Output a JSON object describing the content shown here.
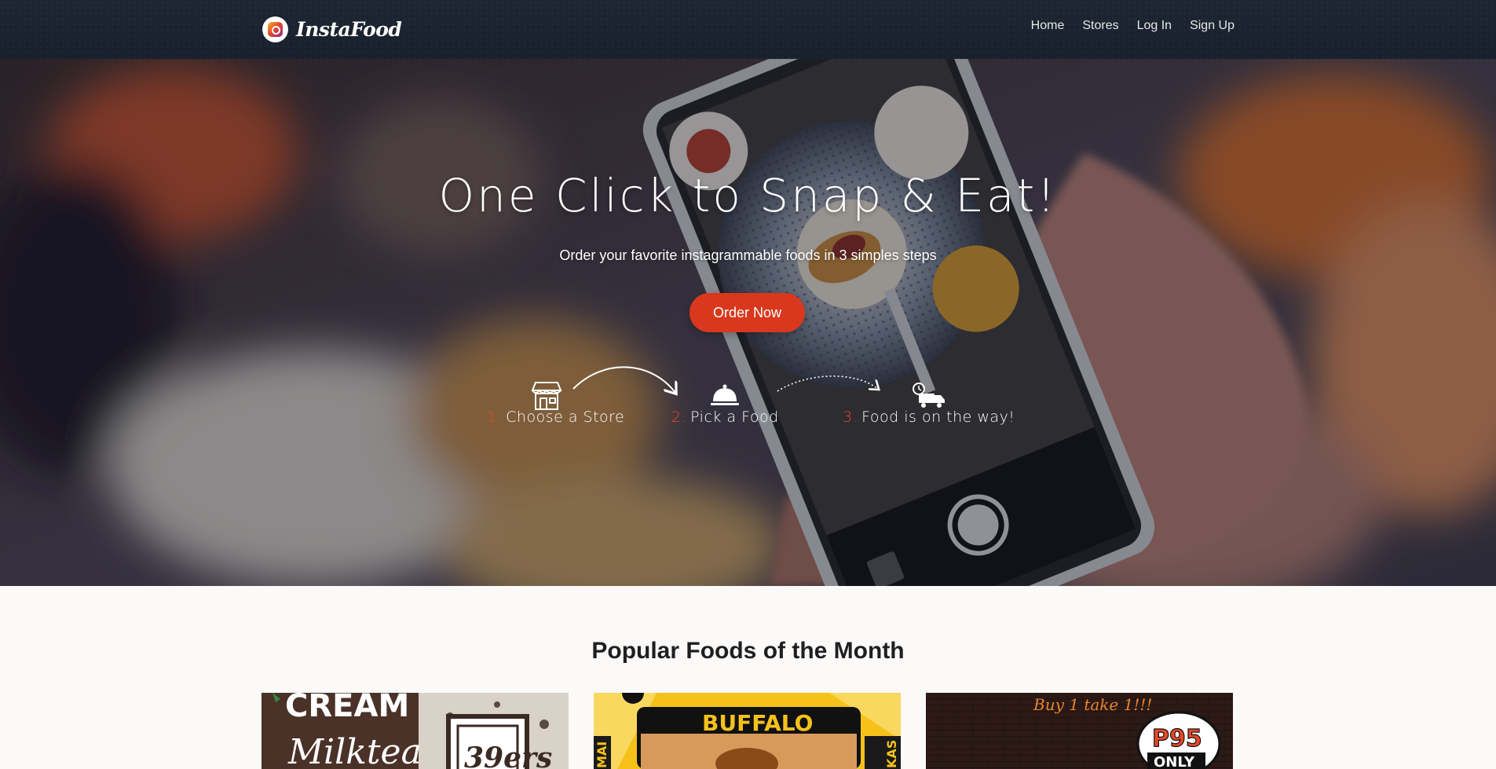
{
  "nav": {
    "brand": "InstaFood",
    "links": [
      "Home",
      "Stores",
      "Log In",
      "Sign Up"
    ]
  },
  "hero": {
    "title": "One Click to Snap & Eat!",
    "subtitle": "Order your favorite instagrammable foods in 3 simples steps",
    "cta": "Order Now",
    "steps": [
      {
        "num": "1.",
        "label": "Choose a Store",
        "icon": "store-icon"
      },
      {
        "num": "2.",
        "label": "Pick a Food",
        "icon": "food-cloche-icon"
      },
      {
        "num": "3.",
        "label": "Food is on the way!",
        "icon": "delivery-truck-icon"
      }
    ]
  },
  "popular": {
    "title": "Popular Foods of the Month",
    "cards": [
      {
        "lines": [
          "CREAM",
          "Milktea",
          "39ers"
        ]
      },
      {
        "lines": [
          "BUFFALO",
          "MAI",
          "KAS"
        ]
      },
      {
        "lines": [
          "Buy 1 take 1!!!",
          "P95",
          "ONLY"
        ]
      }
    ]
  },
  "colors": {
    "navbar": "#1b2330",
    "accent": "#d9381e",
    "step_number": "#e8482a"
  }
}
